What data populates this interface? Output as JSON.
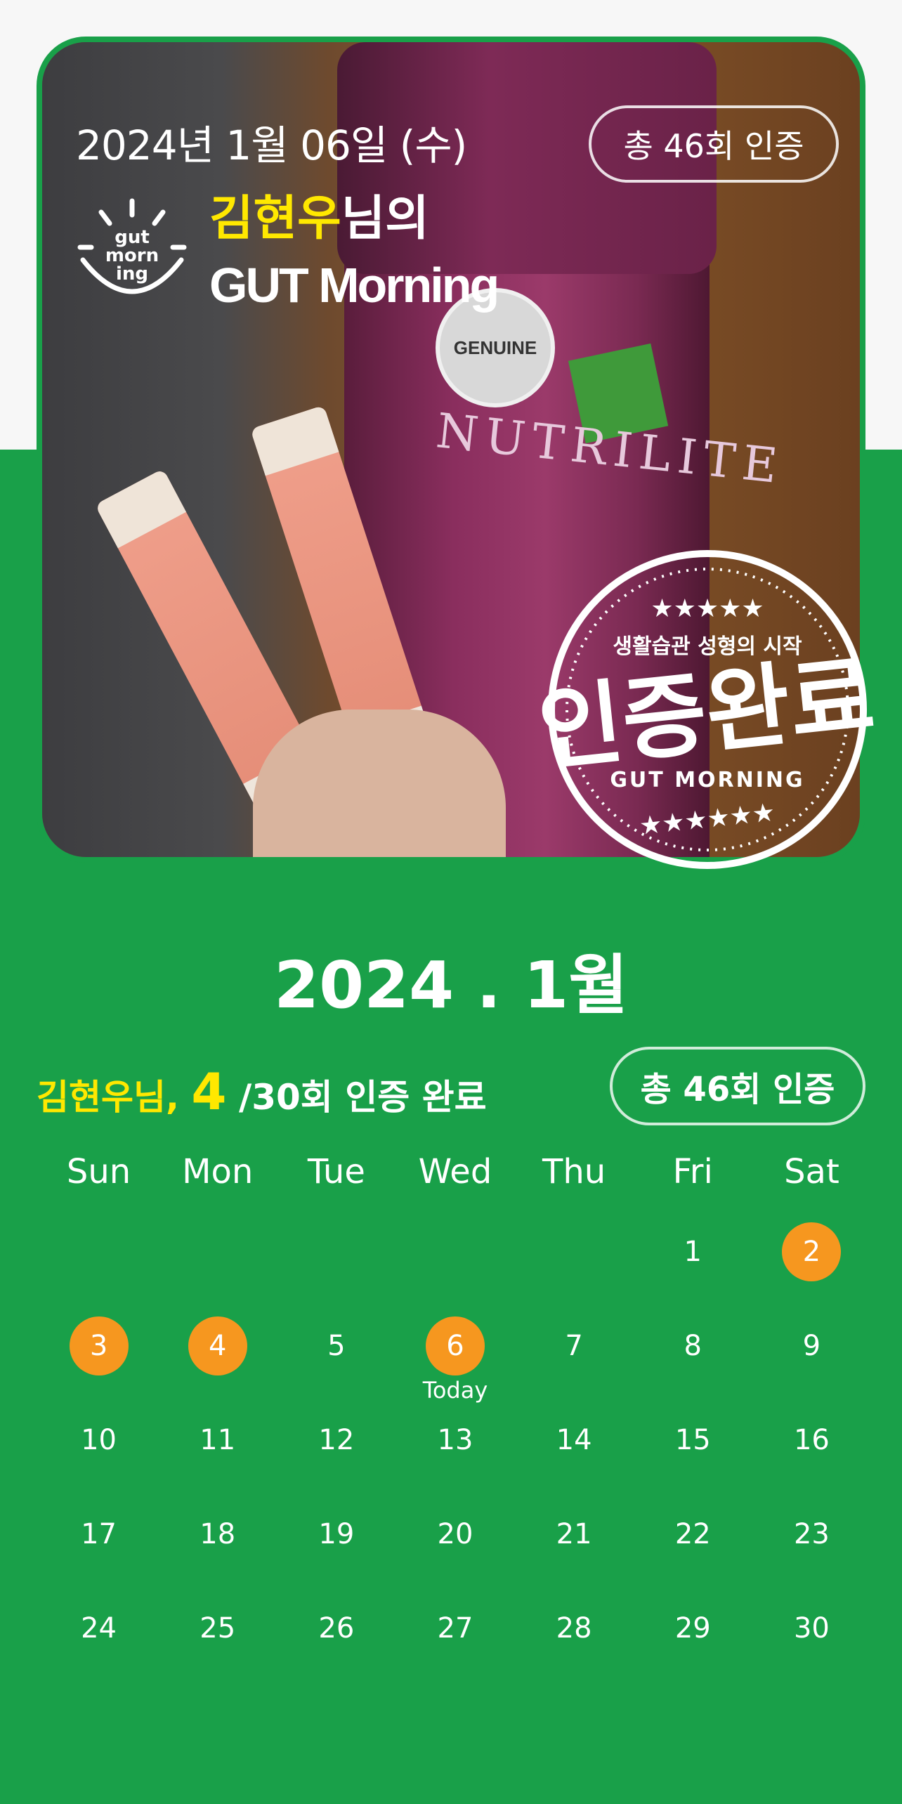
{
  "header": {
    "date": "2024년 1월 06일 (수)",
    "total_badge": "총 46회 인증",
    "user_name": "김현우",
    "name_suffix": "님의",
    "title": "GUT Morning",
    "logo_lines": [
      "gut",
      "morn",
      "ing"
    ]
  },
  "photo": {
    "badge_text": "GENUINE",
    "brand_text": "NUTRILITE"
  },
  "stamp": {
    "top_text": "생활습관 성형의 시작",
    "main_text": "인증완료",
    "bottom_text": "GUT MORNING"
  },
  "calendar": {
    "month_title": "2024 . 1월",
    "summary_name": "김현우님,",
    "summary_count": "4",
    "summary_rest": "/30회 인증 완료",
    "total_badge": "총 46회 인증",
    "weekdays": [
      "Sun",
      "Mon",
      "Tue",
      "Wed",
      "Thu",
      "Fri",
      "Sat"
    ],
    "today_label": "Today",
    "days": [
      "",
      "",
      "",
      "",
      "",
      "1",
      "2",
      "3",
      "4",
      "5",
      "6",
      "7",
      "8",
      "9",
      "10",
      "11",
      "12",
      "13",
      "14",
      "15",
      "16",
      "17",
      "18",
      "19",
      "20",
      "21",
      "22",
      "23",
      "24",
      "25",
      "26",
      "27",
      "28",
      "29",
      "30"
    ],
    "completed_days": [
      "2",
      "3",
      "4",
      "6"
    ],
    "today": "6"
  },
  "colors": {
    "brand_green": "#19a049",
    "highlight_yellow": "#ffe800",
    "completed_orange": "#f6971f"
  }
}
